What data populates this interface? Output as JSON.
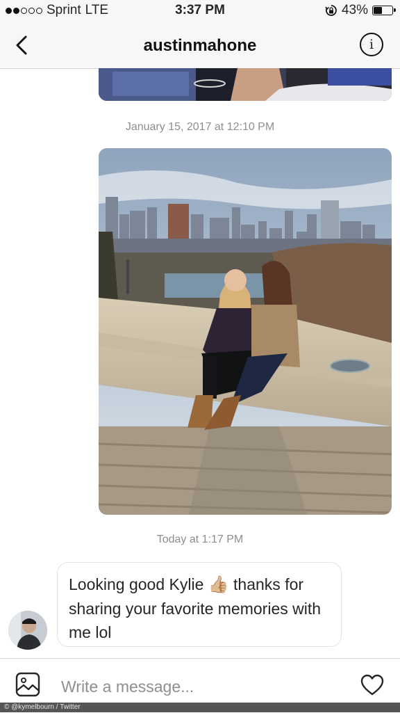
{
  "status_bar": {
    "carrier": "Sprint",
    "network": "LTE",
    "signal_bars": 2,
    "signal_total": 5,
    "time": "3:37 PM",
    "orientation_lock_icon": "rotation-lock-icon",
    "battery_percent": "43%",
    "battery_level": 0.43
  },
  "header": {
    "title": "austinmahone",
    "back_icon": "chevron-left-icon",
    "info_icon": "info-icon"
  },
  "thread": {
    "timestamp_1": "January 15, 2017 at 12:10 PM",
    "timestamp_2": "Today at 1:17 PM",
    "message_part1": "Looking good Kylie",
    "message_emoji": "👍🏼",
    "message_part2": "thanks for sharing your favorite memories with me lol"
  },
  "composer": {
    "placeholder": "Write a message...",
    "gallery_icon": "image-icon",
    "like_icon": "heart-icon"
  },
  "credit": "© @kymelbourn / Twitter",
  "colors": {
    "bar_bg": "#f7f7f7",
    "text": "#262626",
    "muted": "#8e8e8e",
    "border": "#dbdbdb"
  }
}
